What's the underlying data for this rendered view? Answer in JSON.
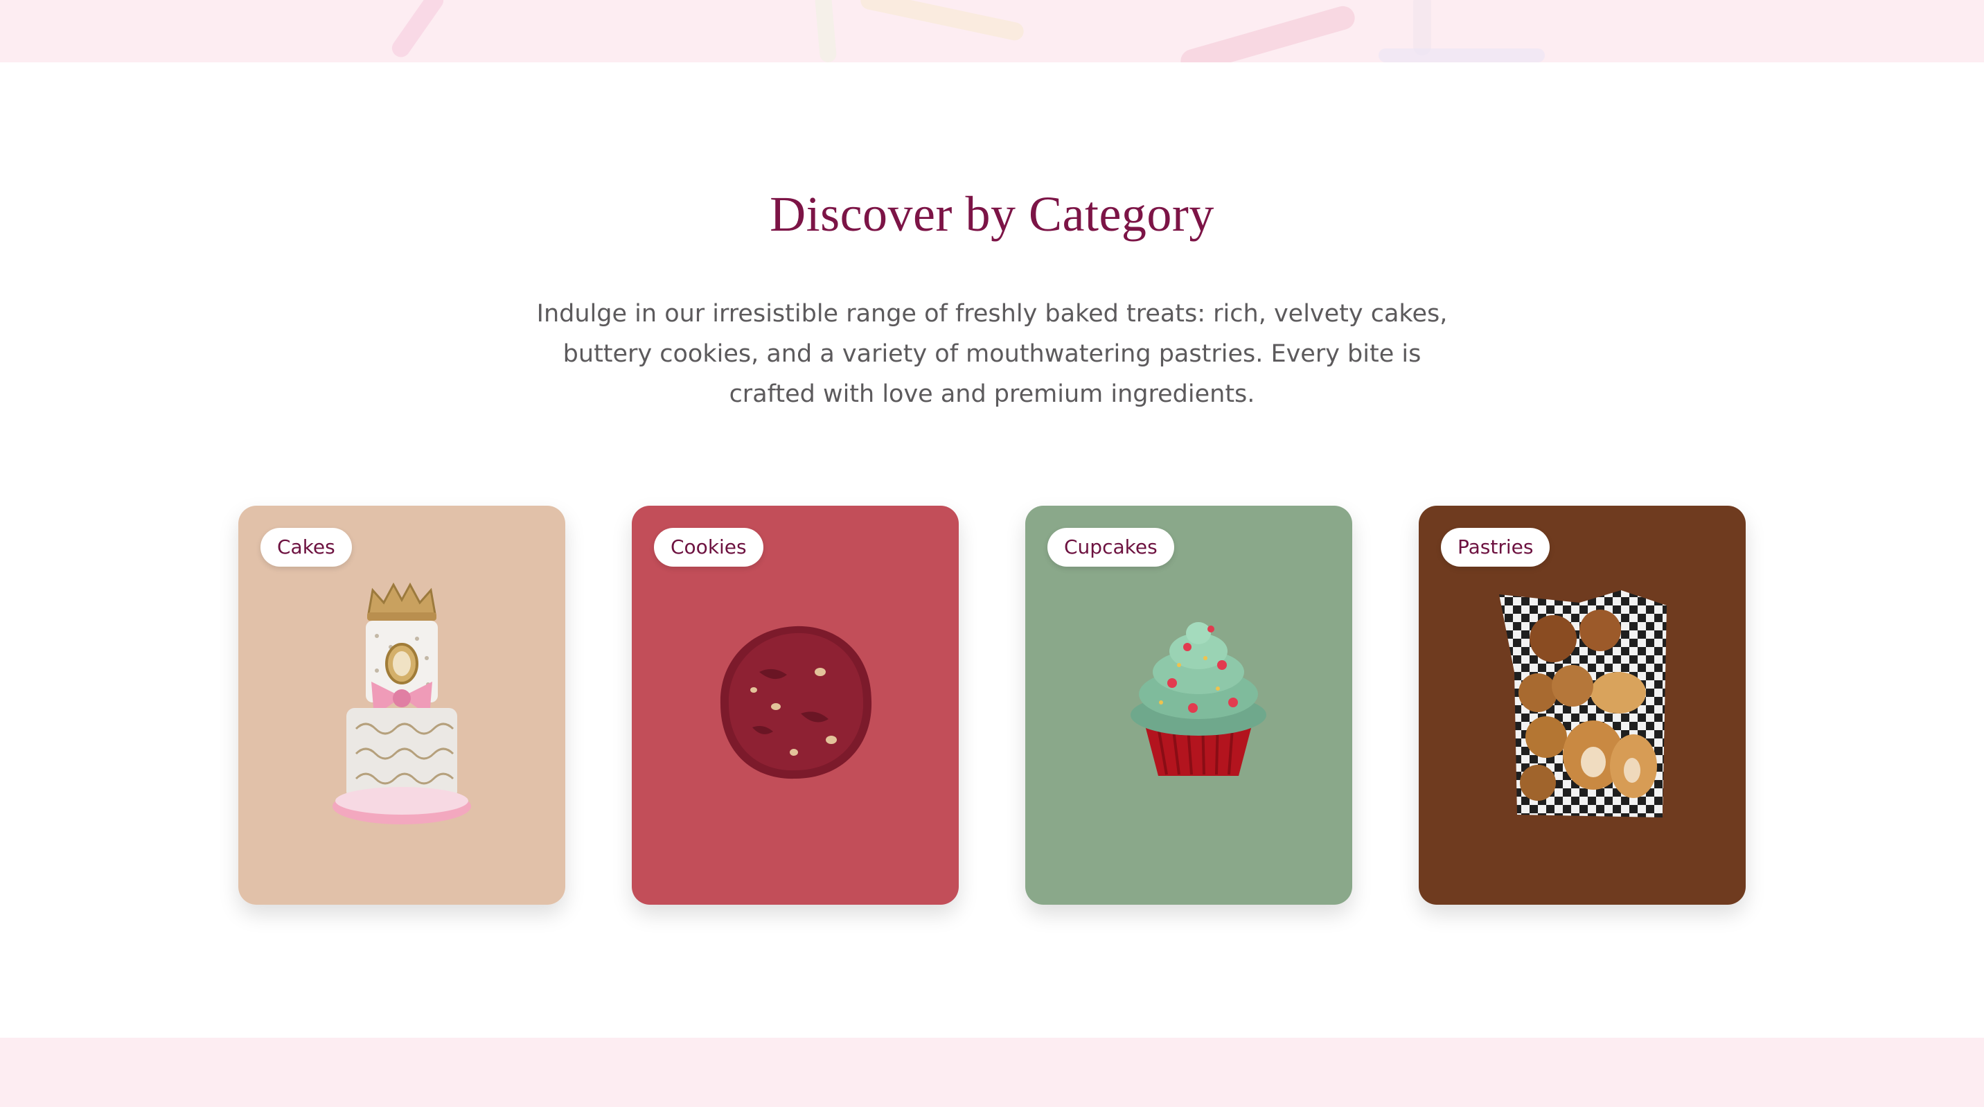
{
  "section": {
    "title": "Discover by Category",
    "description": "Indulge in our irresistible range of freshly baked treats: rich, velvety cakes, buttery cookies, and a variety of mouthwatering pastries. Every bite is crafted with love and premium ingredients."
  },
  "categories": [
    {
      "label": "Cakes",
      "image": "cake-image",
      "background": "#e1c1a9"
    },
    {
      "label": "Cookies",
      "image": "cookie-image",
      "background": "#c24e59"
    },
    {
      "label": "Cupcakes",
      "image": "cupcake-image",
      "background": "#8aa88a"
    },
    {
      "label": "Pastries",
      "image": "pastries-image",
      "background": "#6f3b1f"
    }
  ],
  "colors": {
    "heading": "#7c1446",
    "body_text": "#5c5a5c",
    "band": "#fdedf2",
    "pill_text": "#6d1240"
  }
}
